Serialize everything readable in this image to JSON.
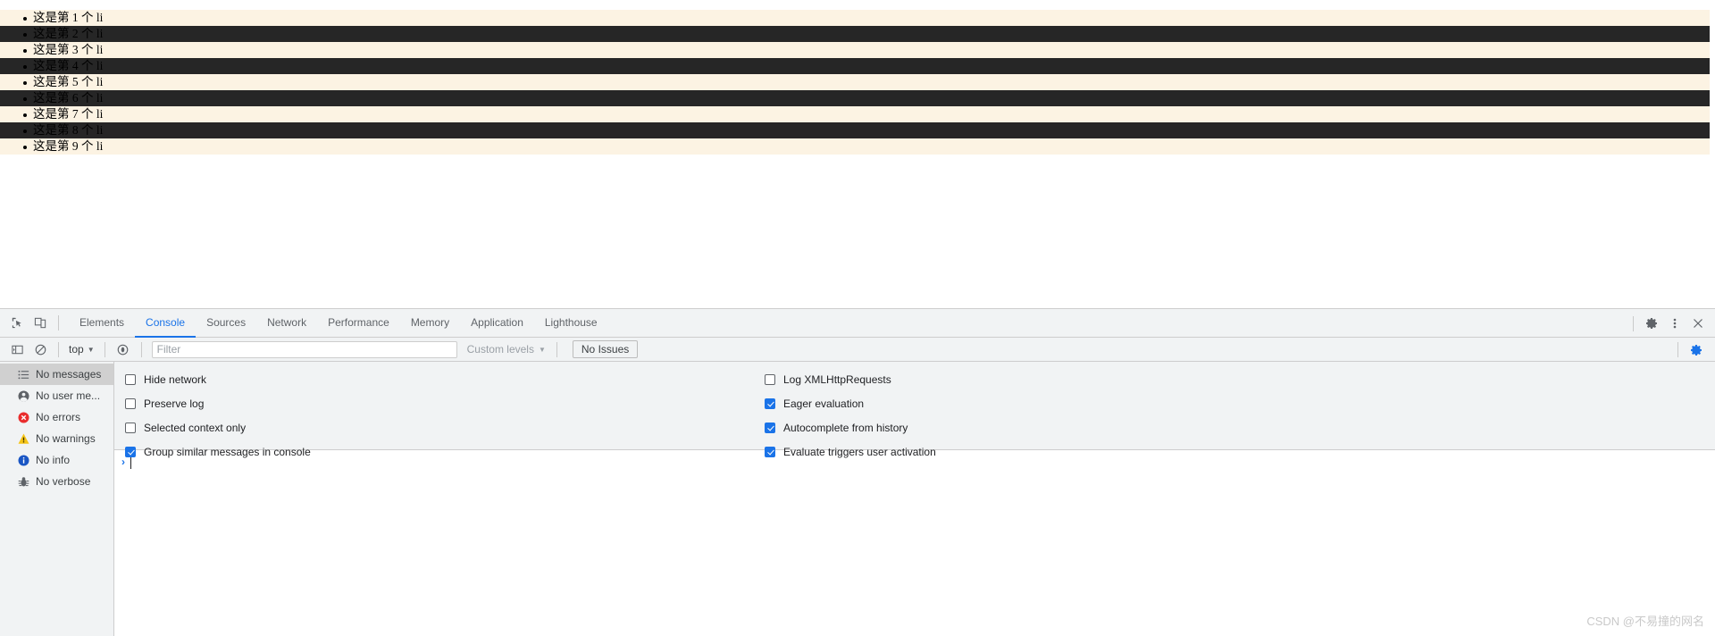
{
  "page": {
    "list_items": [
      {
        "text": "这是第 1 个 li",
        "style": "odd"
      },
      {
        "text": "这是第 2 个 li",
        "style": "even"
      },
      {
        "text": "这是第 3 个 li",
        "style": "odd"
      },
      {
        "text": "这是第 4 个 li",
        "style": "even"
      },
      {
        "text": "这是第 5 个 li",
        "style": "odd"
      },
      {
        "text": "这是第 6 个 li",
        "style": "even"
      },
      {
        "text": "这是第 7 个 li",
        "style": "odd"
      },
      {
        "text": "这是第 8 个 li",
        "style": "even"
      },
      {
        "text": "这是第 9 个 li",
        "style": "odd"
      }
    ],
    "colors": {
      "odd_background": "#FCF3E3",
      "even_background": "#262626",
      "text": "#000000"
    }
  },
  "devtools": {
    "tabs": [
      {
        "label": "Elements",
        "active": false
      },
      {
        "label": "Console",
        "active": true
      },
      {
        "label": "Sources",
        "active": false
      },
      {
        "label": "Network",
        "active": false
      },
      {
        "label": "Performance",
        "active": false
      },
      {
        "label": "Memory",
        "active": false
      },
      {
        "label": "Application",
        "active": false
      },
      {
        "label": "Lighthouse",
        "active": false
      }
    ],
    "tabbar_icons_left": [
      "inspect-element-icon",
      "device-toolbar-icon"
    ],
    "tabbar_icons_right": [
      "settings-gear-icon",
      "more-options-icon",
      "close-icon"
    ],
    "console_toolbar": {
      "sidebar_toggle_icon": "console-sidebar-toggle-icon",
      "clear_icon": "clear-console-icon",
      "context_selector": "top",
      "live_expression_icon": "create-live-expression-icon",
      "filter_placeholder": "Filter",
      "filter_value": "",
      "levels_label": "Custom levels",
      "issues_label": "No Issues",
      "settings_icon": "console-settings-gear-icon"
    },
    "sidebar": [
      {
        "label": "No messages",
        "icon": "list-icon",
        "selected": true
      },
      {
        "label": "No user me...",
        "icon": "person-icon",
        "selected": false
      },
      {
        "label": "No errors",
        "icon": "error-icon",
        "selected": false
      },
      {
        "label": "No warnings",
        "icon": "warning-icon",
        "selected": false
      },
      {
        "label": "No info",
        "icon": "info-icon",
        "selected": false
      },
      {
        "label": "No verbose",
        "icon": "bug-icon",
        "selected": false
      }
    ],
    "settings_left": [
      {
        "label": "Hide network",
        "checked": false
      },
      {
        "label": "Preserve log",
        "checked": false
      },
      {
        "label": "Selected context only",
        "checked": false
      },
      {
        "label": "Group similar messages in console",
        "checked": true
      }
    ],
    "settings_right": [
      {
        "label": "Log XMLHttpRequests",
        "checked": false
      },
      {
        "label": "Eager evaluation",
        "checked": true
      },
      {
        "label": "Autocomplete from history",
        "checked": true
      },
      {
        "label": "Evaluate triggers user activation",
        "checked": true
      }
    ],
    "prompt": {
      "caret": "›",
      "value": "",
      "placeholder": ""
    },
    "colors": {
      "accent": "#1a73e8",
      "toolbar_background": "#f1f3f4",
      "border": "#cdcdcd",
      "text": "#3c4043"
    }
  },
  "watermark": {
    "text": "CSDN @不易撞的网名"
  }
}
